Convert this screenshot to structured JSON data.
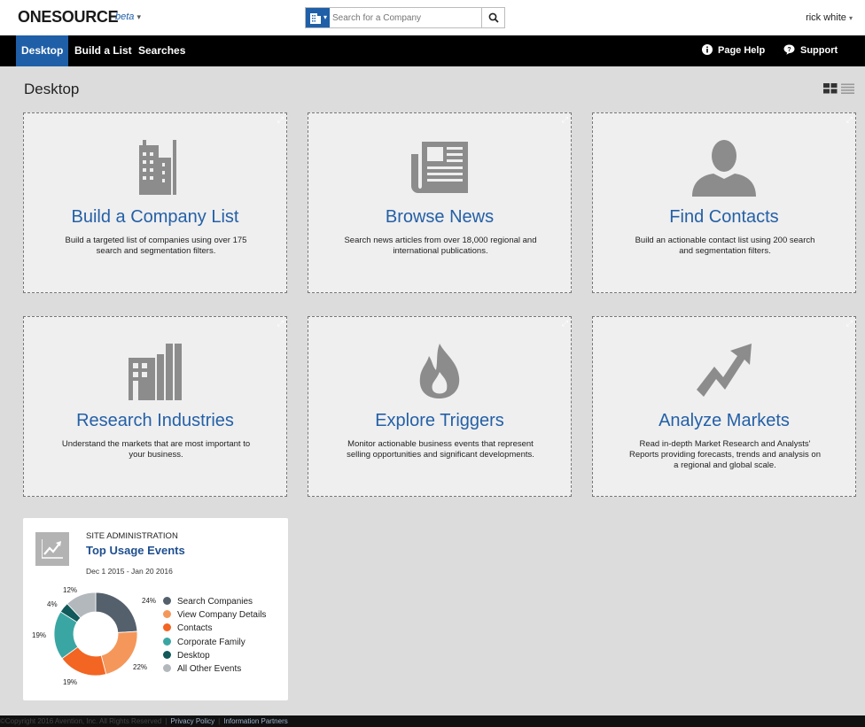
{
  "app": {
    "logo": "ONESOURCE",
    "logo_tag": "beta",
    "search_placeholder": "Search for a Company",
    "user": "rick white"
  },
  "nav": {
    "items": [
      {
        "label": "Desktop",
        "active": true
      },
      {
        "label": "Build a List",
        "active": false
      },
      {
        "label": "Searches",
        "active": false
      }
    ],
    "page_help": "Page Help",
    "support": "Support"
  },
  "page": {
    "title": "Desktop"
  },
  "tiles": [
    {
      "title": "Build a Company List",
      "desc": "Build a targeted list of companies using over 175 search and segmentation filters.",
      "icon": "building-icon"
    },
    {
      "title": "Browse News",
      "desc": "Search news articles from over 18,000 regional and international publications.",
      "icon": "newspaper-icon"
    },
    {
      "title": "Find Contacts",
      "desc": "Build an actionable contact list using 200 search and segmentation filters.",
      "icon": "person-icon"
    },
    {
      "title": "Research Industries",
      "desc": "Understand the markets that are most important to your business.",
      "icon": "factory-icon"
    },
    {
      "title": "Explore Triggers",
      "desc": "Monitor actionable business events that represent selling opportunities and significant developments.",
      "icon": "flame-icon"
    },
    {
      "title": "Analyze Markets",
      "desc": "Read in-depth Market Research and Analysts' Reports providing forecasts, trends and analysis on a regional and global scale.",
      "icon": "trend-arrow-icon"
    }
  ],
  "widget": {
    "category": "SITE ADMINISTRATION",
    "title": "Top Usage Events",
    "date_range": "Dec 1 2015 - Jan 20 2016",
    "icon": "trend-chart-icon"
  },
  "chart_data": {
    "type": "pie",
    "categories": [
      "Search Companies",
      "View Company Details",
      "Contacts",
      "Corporate Family",
      "Desktop",
      "All Other Events"
    ],
    "values": [
      24,
      22,
      19,
      19,
      4,
      12
    ],
    "labels": [
      "24%",
      "22%",
      "19%",
      "19%",
      "4%",
      "12%"
    ],
    "colors": [
      "#55606d",
      "#f5975a",
      "#f26522",
      "#3aa6a4",
      "#11595a",
      "#b3b8bd"
    ],
    "legend_position": "right",
    "donut": true
  },
  "footer": {
    "copyright": "©Copyright 2016 Avention, Inc. All Rights Reserved",
    "privacy": "Privacy Policy",
    "partners": "Information Partners"
  }
}
